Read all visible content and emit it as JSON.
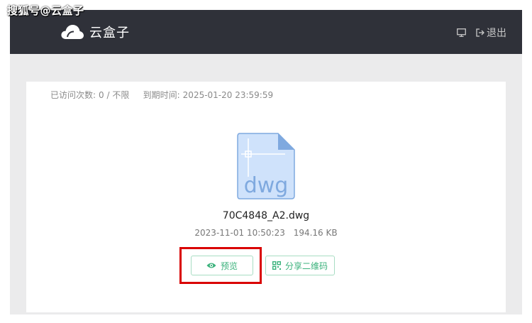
{
  "watermark": "搜狐号@云盒子",
  "header": {
    "app_name": "云盒子",
    "logout_label": "退出",
    "icons": [
      "cloud-logo-icon",
      "monitor-icon",
      "logout-icon"
    ],
    "bg_color": "#2f3139"
  },
  "share_info": {
    "visits_label": "已访问次数:",
    "visits_value": "0 / 不限",
    "expiry_label": "到期时间:",
    "expiry_value": "2025-01-20 23:59:59"
  },
  "file": {
    "icon_text": "dwg",
    "name": "70C4848_A2.dwg",
    "date": "2023-11-01 10:50:23",
    "size": "194.16 KB"
  },
  "actions": {
    "preview_label": "预览",
    "share_qr_label": "分享二维码",
    "accent_color": "#3bb27c",
    "highlight_color": "#d90000"
  }
}
